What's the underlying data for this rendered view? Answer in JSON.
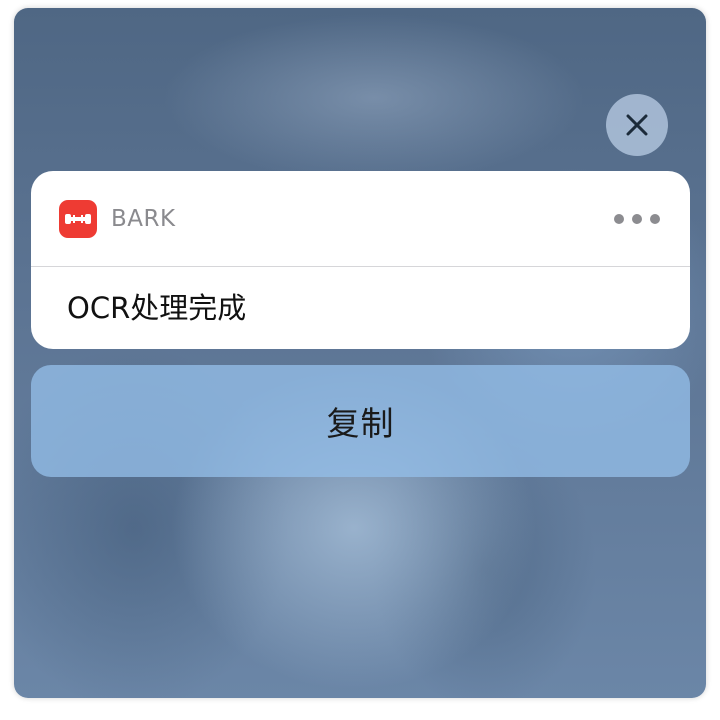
{
  "notification": {
    "app_name": "BARK",
    "app_icon": "bark-app-icon",
    "message": "OCR处理完成",
    "more_icon": "more-dots-icon"
  },
  "actions": {
    "copy_label": "复制"
  },
  "close_icon": "close-icon",
  "colors": {
    "app_icon_bg": "#ee3b33",
    "card_bg": "#ffffff",
    "action_bg": "#94bee8"
  }
}
